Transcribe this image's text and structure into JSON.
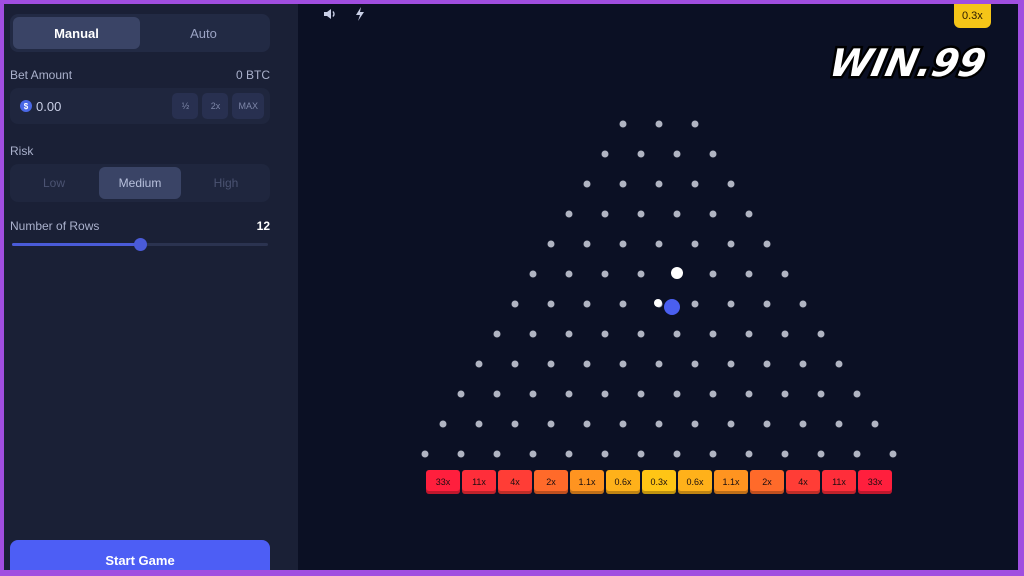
{
  "controls": {
    "mode_tabs": [
      "Manual",
      "Auto"
    ],
    "active_mode": "Manual",
    "bet_amount_label": "Bet Amount",
    "bet_amount_currency_value": "0 BTC",
    "bet_value": "0.00",
    "coin_symbol": "$",
    "bet_buttons": [
      "½",
      "2x",
      "MAX"
    ],
    "risk_label": "Risk",
    "risk_options": [
      "Low",
      "Medium",
      "High"
    ],
    "active_risk": "Medium",
    "rows_label": "Number of Rows",
    "rows_value": "12",
    "rows_slider_fraction": 0.5,
    "start_label": "Start Game"
  },
  "top_bar": {
    "icons": [
      "speaker-icon",
      "lightning-icon"
    ],
    "last_result": "0.3x"
  },
  "logo": {
    "text": "WIN.99"
  },
  "board": {
    "rows": 12,
    "multipliers": [
      "33x",
      "11x",
      "4x",
      "2x",
      "1.1x",
      "0.6x",
      "0.3x",
      "0.6x",
      "1.1x",
      "2x",
      "4x",
      "11x",
      "33x"
    ],
    "slot_colors": [
      "#ff1f3d",
      "#ff2e3a",
      "#ff3d36",
      "#ff6a2a",
      "#ff9420",
      "#ffb11a",
      "#ffc515",
      "#ffb11a",
      "#ff9420",
      "#ff6a2a",
      "#ff3d36",
      "#ff2e3a",
      "#ff1f3d"
    ]
  },
  "colors": {
    "accent": "#4d5ef5",
    "badge": "#f5c518",
    "background": "#0b1024"
  }
}
